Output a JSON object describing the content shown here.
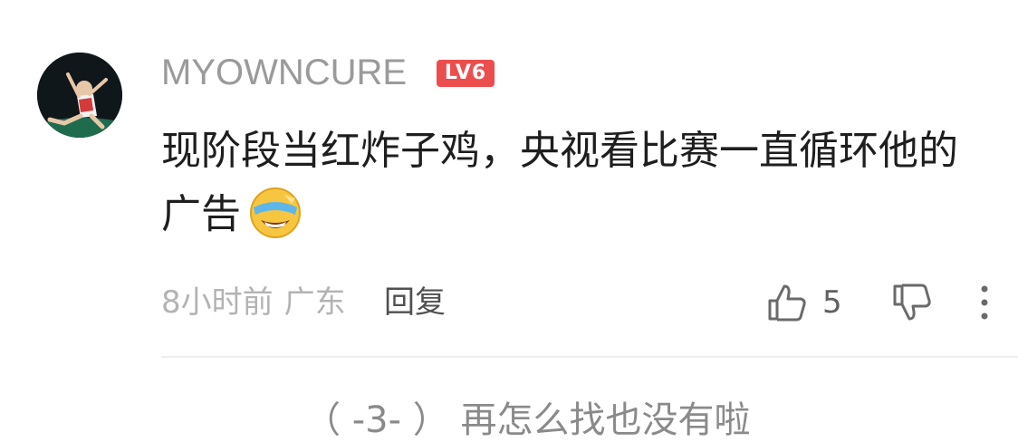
{
  "comment": {
    "username": "MYOWNCURE",
    "level_badge": "LV6",
    "text": "现阶段当红炸子鸡，央视看比赛一直循环他的广告",
    "emoji_icon": "laugh-cry-emoji-icon",
    "time": "8小时前",
    "location": "广东",
    "reply_label": "回复",
    "like_count": "5"
  },
  "footer": {
    "expand_text": "（ -3- ） 再怎么找也没有啦"
  },
  "colors": {
    "username": "#9a9a9a",
    "badge": "#ec4e4e",
    "text": "#1e1e1e",
    "meta": "#b3b3b3",
    "icon": "#6a6a6a"
  }
}
